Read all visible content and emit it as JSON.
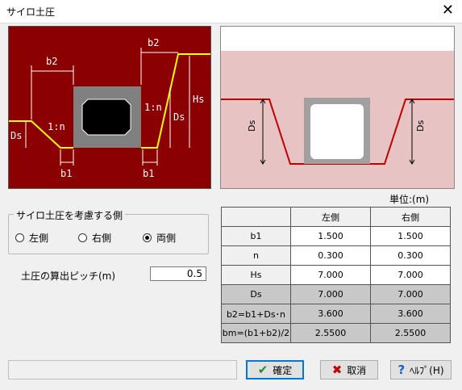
{
  "window": {
    "title": "サイロ土圧",
    "close_glyph": "✕"
  },
  "left_diagram": {
    "labels": {
      "b2_left": "b2",
      "b2_right": "b2",
      "slope_left": "1:n",
      "slope_right": "1:n",
      "ds_left": "Ds",
      "ds_right": "Ds",
      "hs": "Hs",
      "b1_left": "b1",
      "b1_right": "b1"
    },
    "colors": {
      "background": "#8b0000",
      "lines": "#ffffff",
      "ground": "#ffff00",
      "culvert": "#808080"
    }
  },
  "right_diagram": {
    "labels": {
      "ds_left": "Ds",
      "ds_right": "Ds"
    },
    "colors": {
      "soil": "#e8c3c3",
      "line": "#c00000"
    }
  },
  "unit_label": "単位:(m)",
  "side_group": {
    "legend": "サイロ土圧を考慮する側",
    "options": [
      {
        "label": "左側",
        "selected": false
      },
      {
        "label": "右側",
        "selected": false
      },
      {
        "label": "両側",
        "selected": true
      }
    ]
  },
  "pitch": {
    "label": "土圧の算出ピッチ(m)",
    "value": "0.5"
  },
  "table": {
    "headers": [
      "",
      "左側",
      "右側"
    ],
    "rows": [
      {
        "label": "b1",
        "left": "1.500",
        "right": "1.500"
      },
      {
        "label": "n",
        "left": "0.300",
        "right": "0.300"
      },
      {
        "label": "Hs",
        "left": "7.000",
        "right": "7.000"
      },
      {
        "label": "Ds",
        "left": "7.000",
        "right": "7.000"
      },
      {
        "label": "b2=b1+Ds･n",
        "left": "3.600",
        "right": "3.600"
      },
      {
        "label": "bm=(b1+b2)/2",
        "left": "2.5500",
        "right": "2.5500"
      }
    ]
  },
  "buttons": {
    "ok": "確定",
    "cancel": "取消",
    "help": "ﾍﾙﾌﾟ(H)"
  }
}
